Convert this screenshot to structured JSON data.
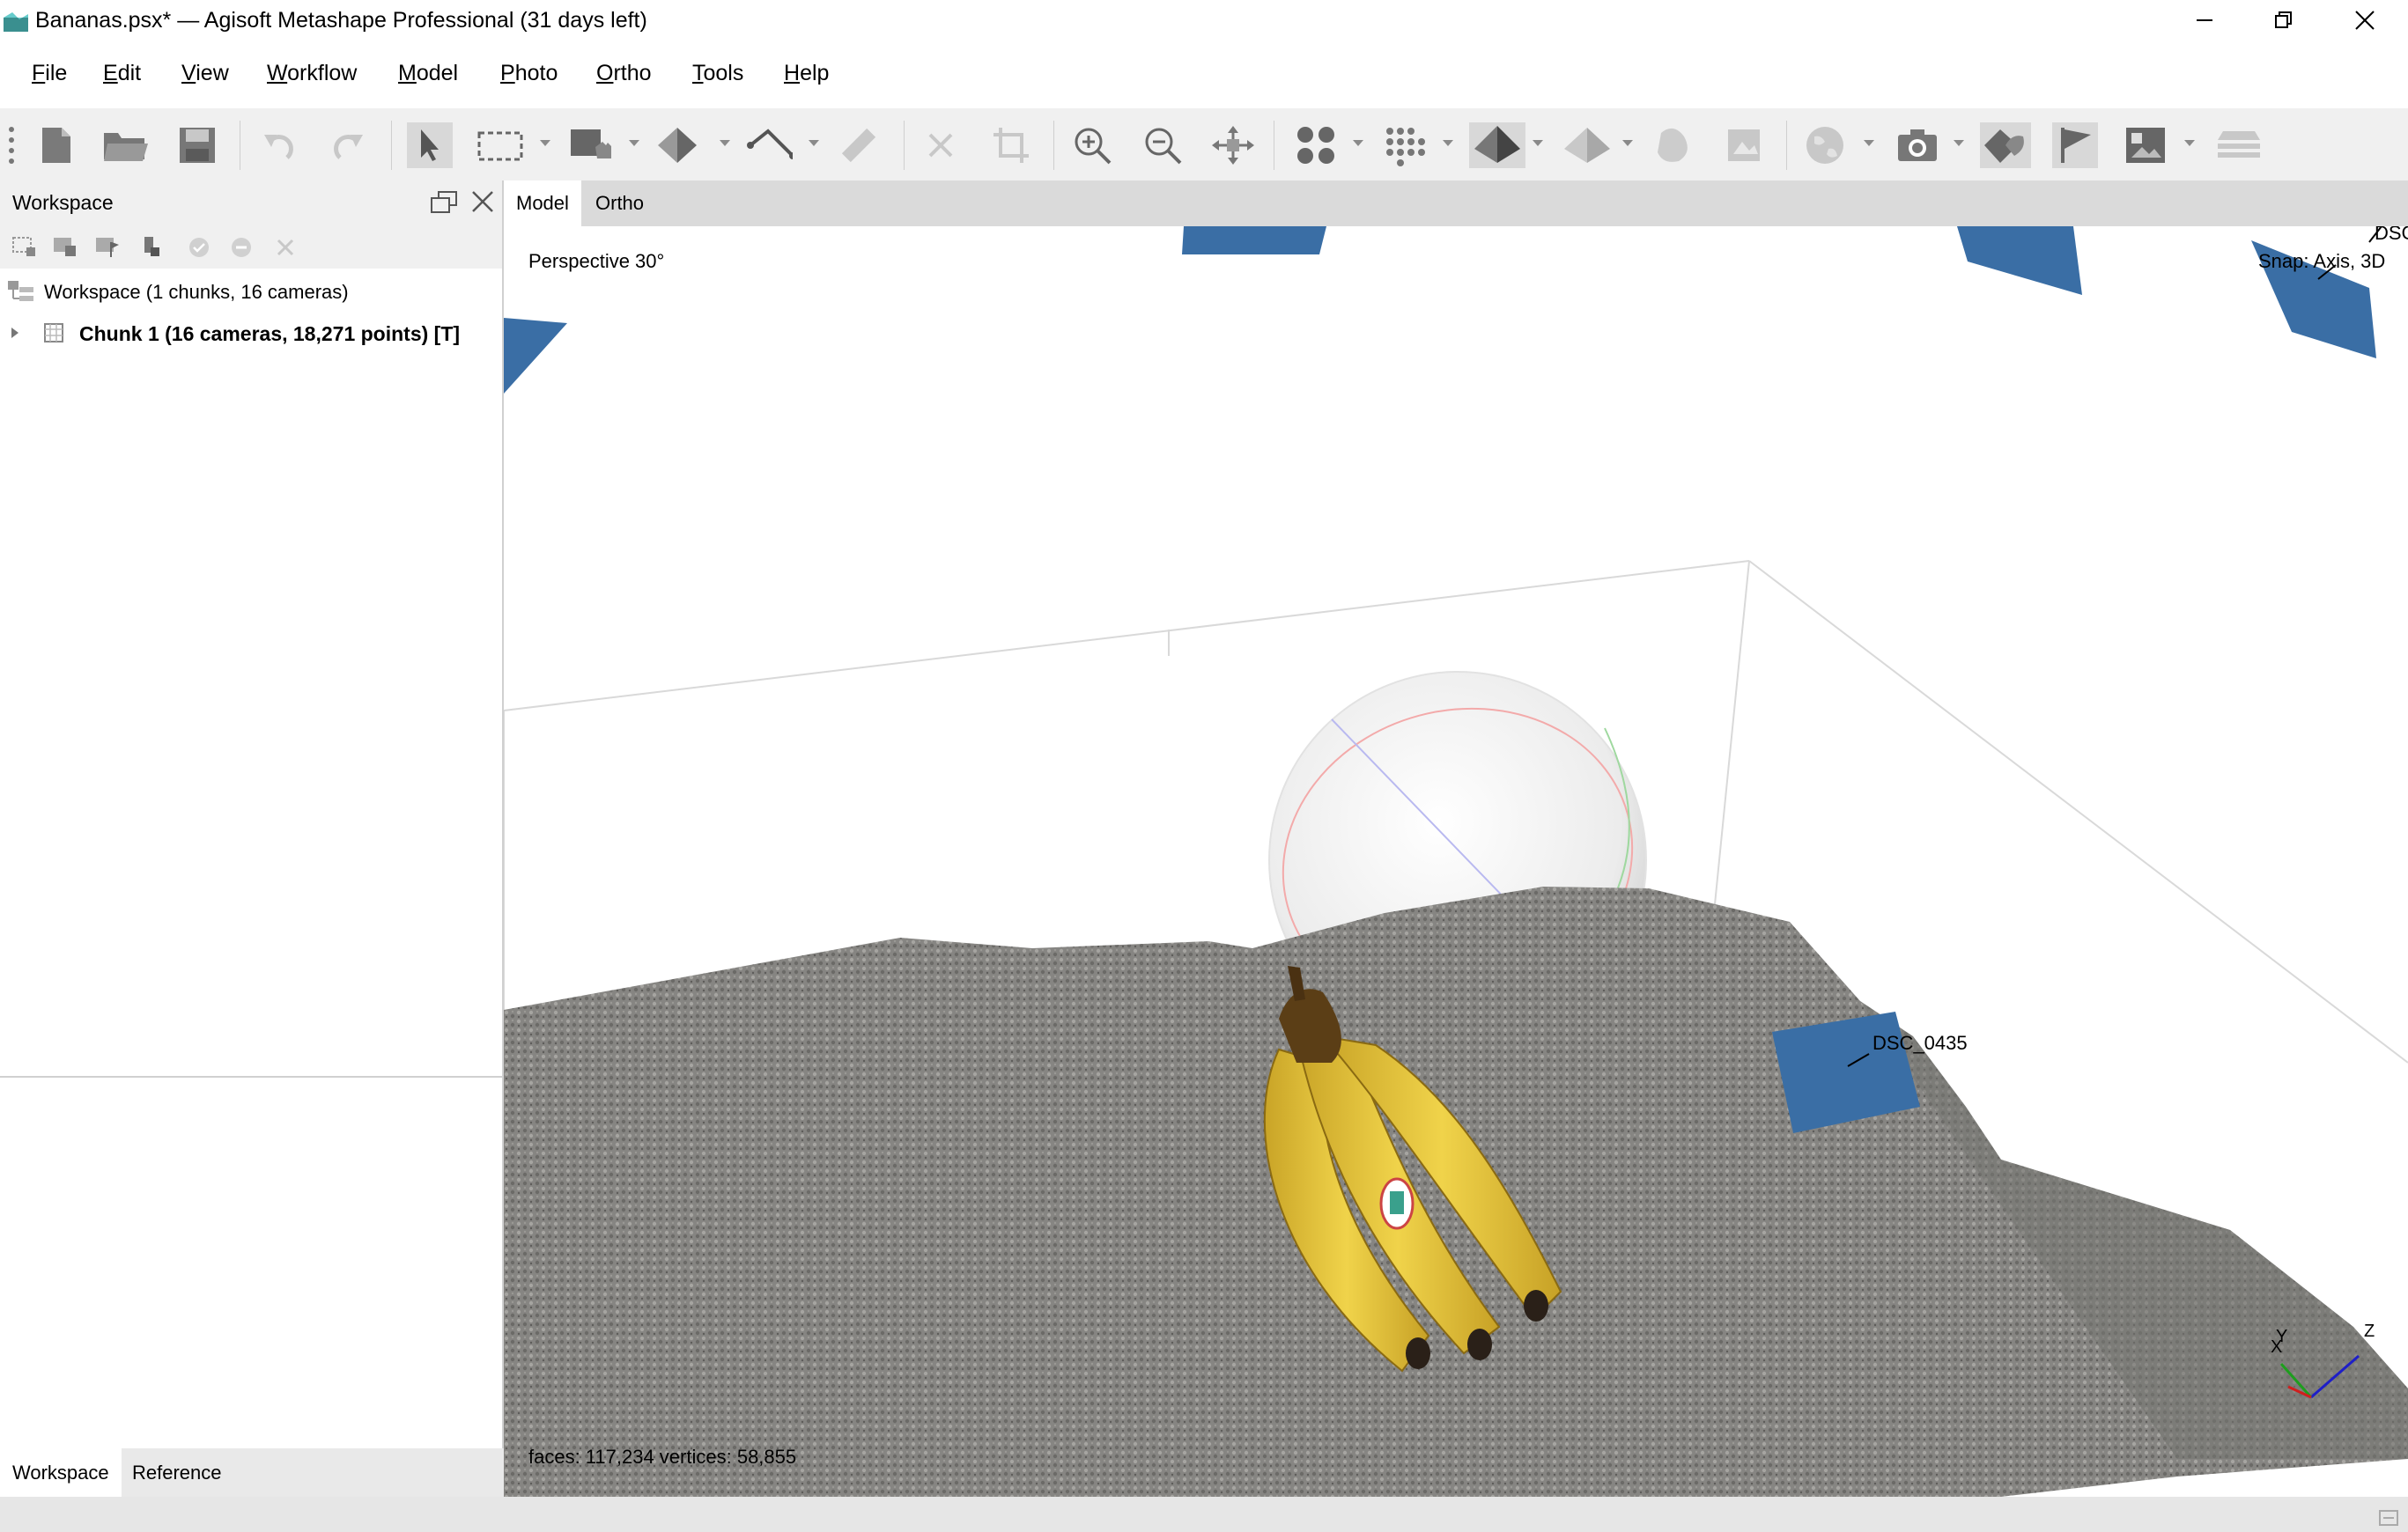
{
  "window": {
    "title": "Bananas.psx* — Agisoft Metashape Professional (31 days left)",
    "controls": [
      "minimize",
      "restore",
      "close"
    ]
  },
  "menu": [
    "File",
    "Edit",
    "View",
    "Workflow",
    "Model",
    "Photo",
    "Ortho",
    "Tools",
    "Help"
  ],
  "toolbar": {
    "buttons": [
      "new-document-icon",
      "open-folder-icon",
      "save-icon",
      "undo-icon",
      "redo-icon",
      "select-arrow-icon",
      "rectangle-selection-icon",
      "draw-polygon-icon",
      "rotate-object-icon",
      "draw-polyline-icon",
      "ruler-icon",
      "delete-selection-icon",
      "crop-icon",
      "zoom-in-icon",
      "zoom-out-icon",
      "reset-view-icon",
      "point-cloud-icon",
      "dense-cloud-icon",
      "shaded-model-icon",
      "solid-model-icon",
      "texture-mask-icon",
      "orthomosaic-icon",
      "globe-icon",
      "camera-icon",
      "show-markers-icon",
      "flag-icon",
      "image-icon",
      "layers-icon"
    ]
  },
  "workspace_panel": {
    "title": "Workspace",
    "tree": {
      "root": "Workspace (1 chunks, 16 cameras)",
      "chunk": "Chunk 1 (16 cameras, 18,271 points) [T]"
    },
    "bottom_tabs": [
      "Workspace",
      "Reference"
    ],
    "active_tab": "Workspace"
  },
  "viewport": {
    "tabs": [
      "Model",
      "Ortho"
    ],
    "active_tab": "Model",
    "projection": "Perspective 30°",
    "snap": "Snap: Axis, 3D",
    "camera_labels": [
      "DSC_0435",
      "DSC"
    ],
    "stats": "faces: 117,234 vertices: 58,855",
    "axes": [
      "X",
      "Y",
      "Z"
    ],
    "camera_color": "#3a6ea5"
  }
}
